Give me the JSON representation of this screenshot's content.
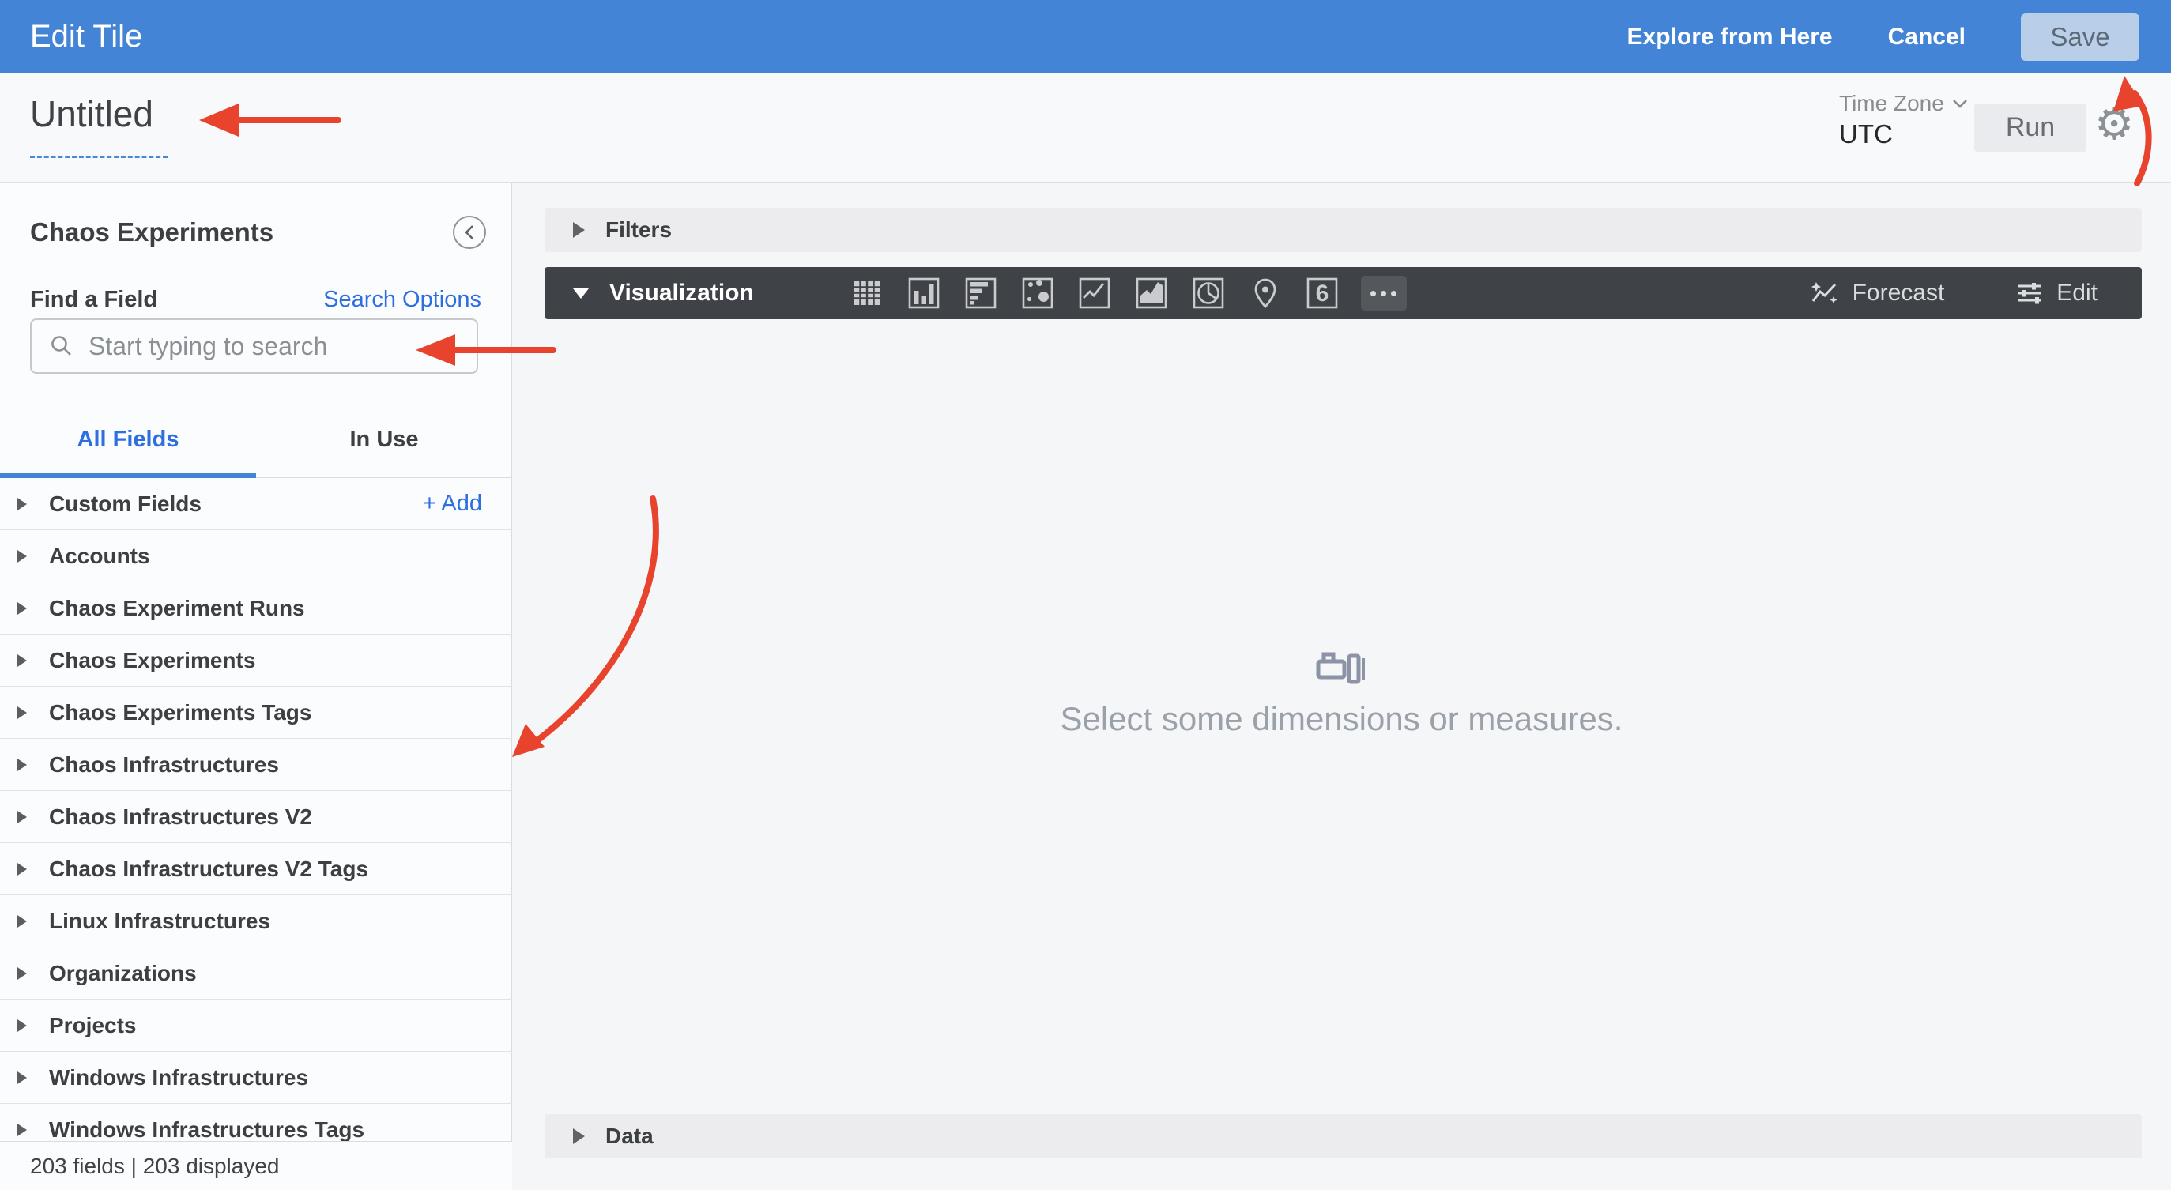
{
  "topbar": {
    "title": "Edit Tile",
    "explore_label": "Explore from Here",
    "cancel_label": "Cancel",
    "save_label": "Save"
  },
  "toolbar": {
    "title": "Untitled",
    "time_zone_label": "Time Zone",
    "time_zone_value": "UTC",
    "run_label": "Run",
    "gear_glyph": "⚙"
  },
  "sidebar": {
    "title": "Chaos Experiments",
    "find_a_field_label": "Find a Field",
    "search_options_label": "Search Options",
    "search_placeholder": "Start typing to search",
    "tab_all_fields": "All Fields",
    "tab_in_use": "In Use",
    "custom_fields_label": "Custom Fields",
    "add_label": "+ Add",
    "groups": [
      "Accounts",
      "Chaos Experiment Runs",
      "Chaos Experiments",
      "Chaos Experiments Tags",
      "Chaos Infrastructures",
      "Chaos Infrastructures V2",
      "Chaos Infrastructures V2 Tags",
      "Linux Infrastructures",
      "Organizations",
      "Projects",
      "Windows Infrastructures",
      "Windows Infrastructures Tags"
    ],
    "footer": "203 fields | 203 displayed"
  },
  "main": {
    "filters_label": "Filters",
    "visualization_label": "Visualization",
    "viz_icon_names": [
      "table",
      "column-chart",
      "bar-chart",
      "scatter",
      "line-chart",
      "area-chart",
      "pie-chart",
      "map",
      "single-value",
      "more"
    ],
    "single_value_glyph": "6",
    "forecast_label": "Forecast",
    "edit_label": "Edit",
    "empty_message": "Select some dimensions or measures.",
    "data_label": "Data"
  },
  "colors": {
    "topbar_blue": "#4484d7",
    "link_blue": "#2d6fe0",
    "tab_underline_blue": "#4285d4",
    "viz_bar_dark": "#3f4347",
    "annotation_red": "#e8432c",
    "save_btn_bg": "#b9cee9"
  }
}
